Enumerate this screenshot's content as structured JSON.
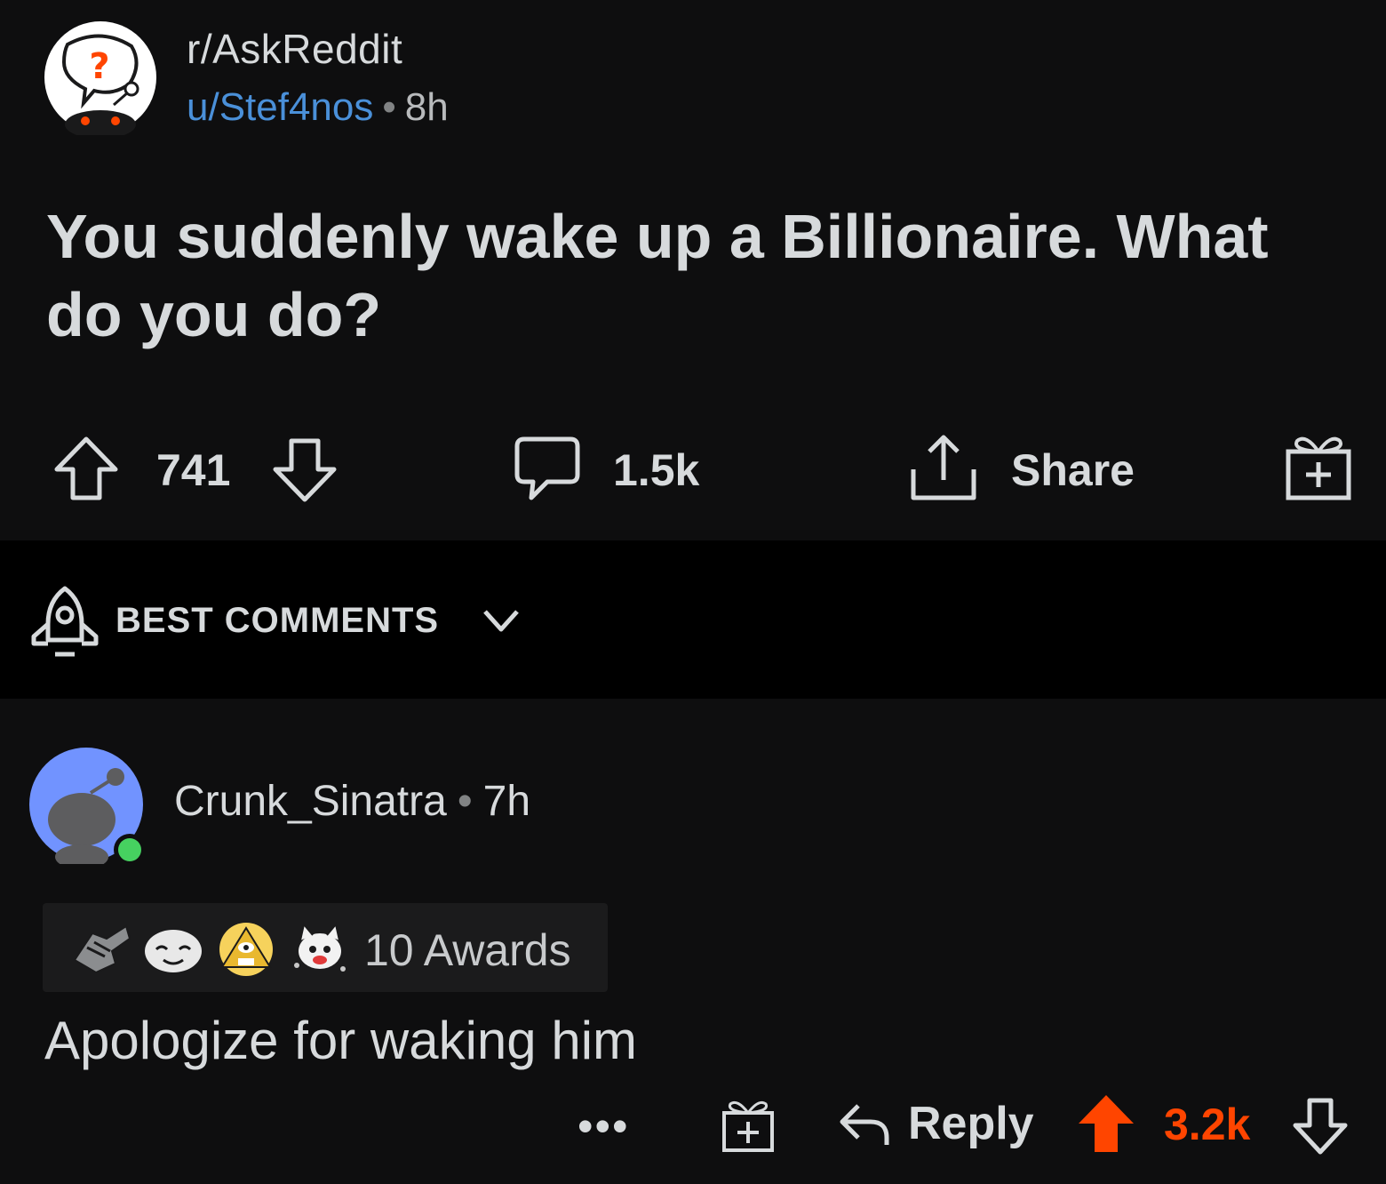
{
  "post": {
    "subreddit": "r/AskReddit",
    "author": "u/Stef4nos",
    "separator": "•",
    "age": "8h",
    "title": "You suddenly wake up a Billionaire. What do you do?",
    "upvotes": "741",
    "comments_count": "1.5k",
    "share_label": "Share"
  },
  "sort": {
    "label": "BEST COMMENTS"
  },
  "comment": {
    "author": "Crunk_Sinatra",
    "separator": "•",
    "age": "7h",
    "awards_label": "10 Awards",
    "body": "Apologize for waking him",
    "reply_label": "Reply",
    "score": "3.2k"
  },
  "colors": {
    "accent_upvote": "#ff4500",
    "author_link": "#4a90d9",
    "online_status": "#46d160",
    "avatar_bg": "#7193ff"
  },
  "icons": {
    "subreddit_avatar": "askreddit-question-icon",
    "upvote": "arrow-up-icon",
    "downvote": "arrow-down-icon",
    "comment": "comment-bubble-icon",
    "share": "share-icon",
    "award": "gift-icon",
    "sort": "rocket-icon",
    "chevron": "chevron-down-icon",
    "reply": "reply-arrow-icon",
    "more": "more-dots-icon"
  }
}
